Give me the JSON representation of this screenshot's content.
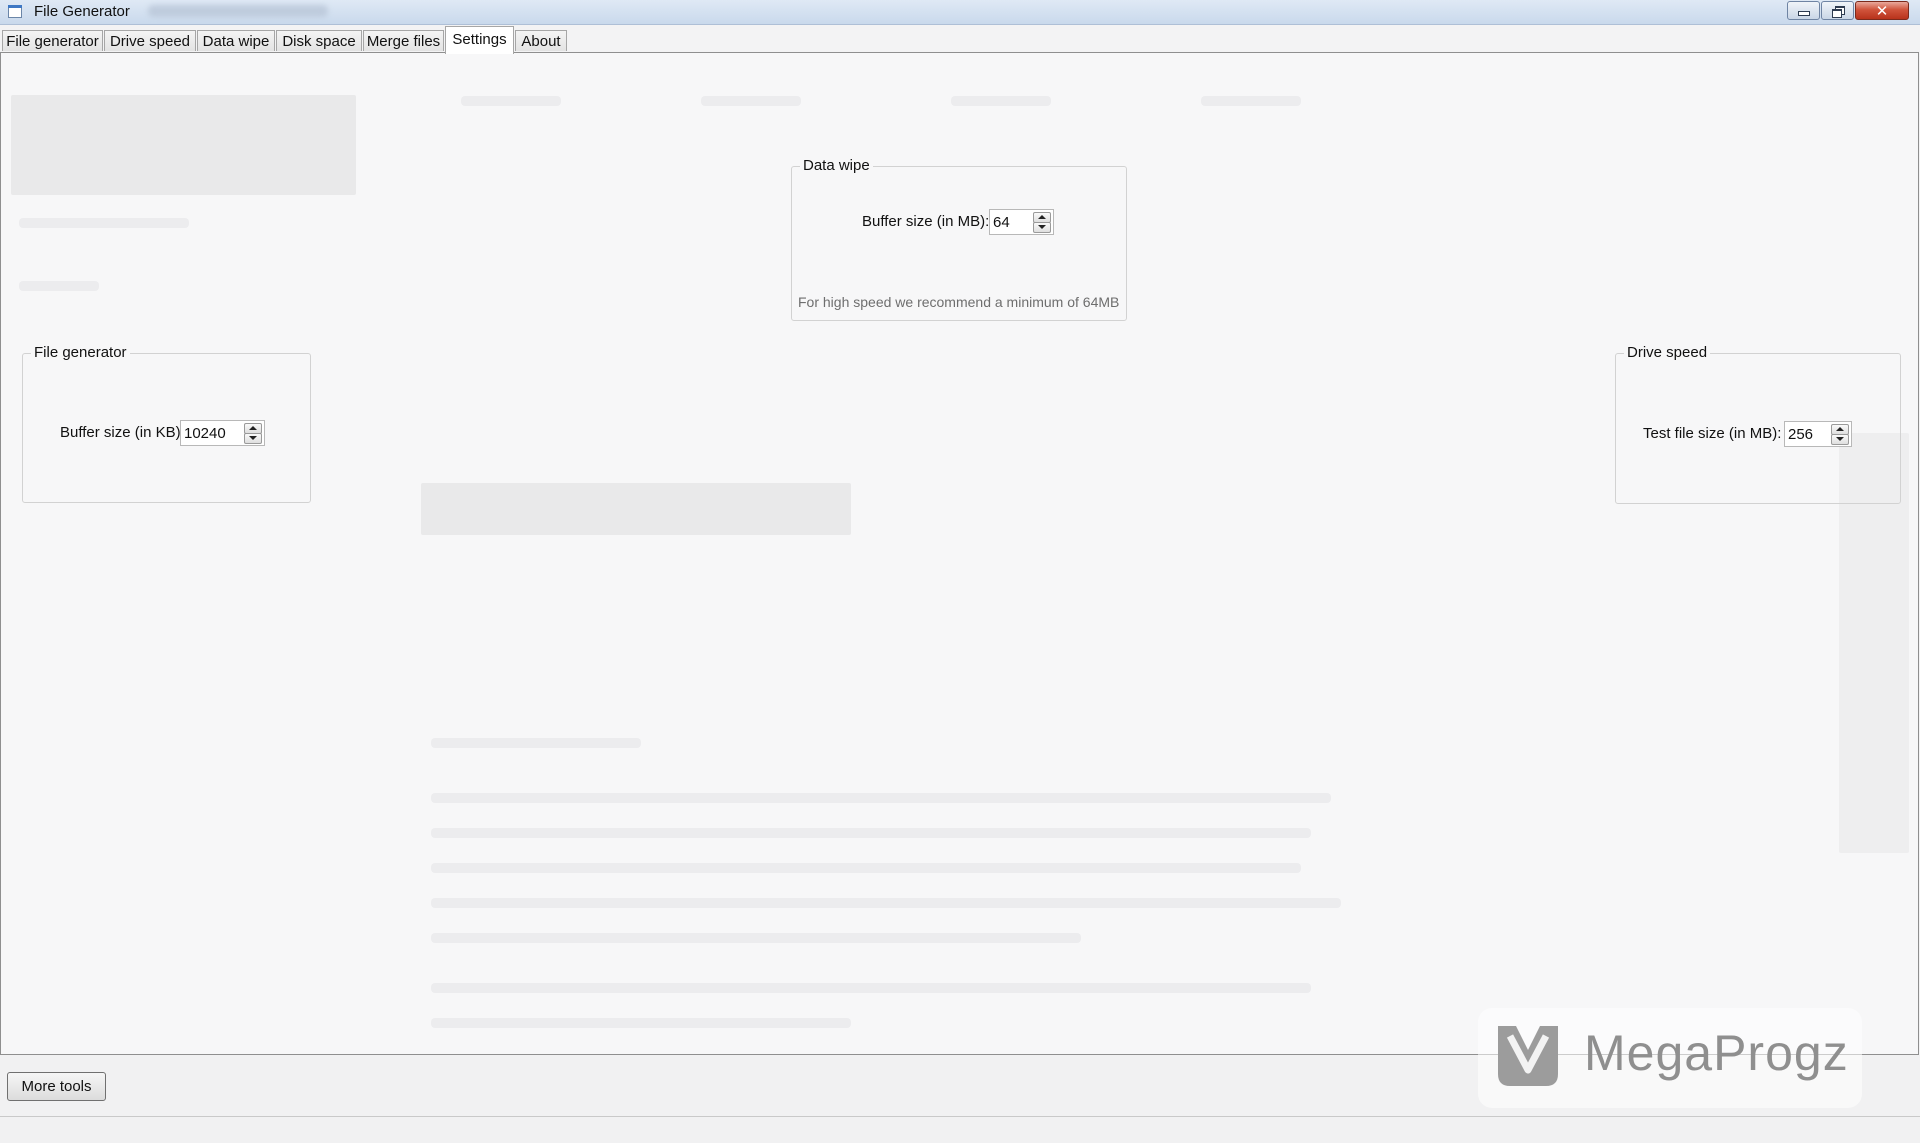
{
  "window": {
    "title": "File Generator",
    "buttons": {
      "minimize": "minimize",
      "restore": "restore",
      "close": "✕"
    }
  },
  "tabs": [
    {
      "label": "File generator"
    },
    {
      "label": "Drive speed"
    },
    {
      "label": "Data wipe"
    },
    {
      "label": "Disk space"
    },
    {
      "label": "Merge files"
    },
    {
      "label": "Settings",
      "active": true
    },
    {
      "label": "About"
    }
  ],
  "settings": {
    "data_wipe": {
      "legend": "Data wipe",
      "buffer_label": "Buffer size (in MB):",
      "buffer_value": "64",
      "hint": "For high speed we recommend a minimum of 64MB"
    },
    "file_generator": {
      "legend": "File generator",
      "buffer_label": "Buffer size (in KB):",
      "buffer_value": "10240"
    },
    "drive_speed": {
      "legend": "Drive speed",
      "test_label": "Test file size (in MB):",
      "test_value": "256"
    }
  },
  "footer": {
    "more_tools_label": "More tools"
  },
  "watermark": {
    "text": "MegaProgz"
  },
  "colors": {
    "titlebar": "#c9d9ec",
    "close_button": "#c7432a",
    "background": "#f7f7f8"
  }
}
